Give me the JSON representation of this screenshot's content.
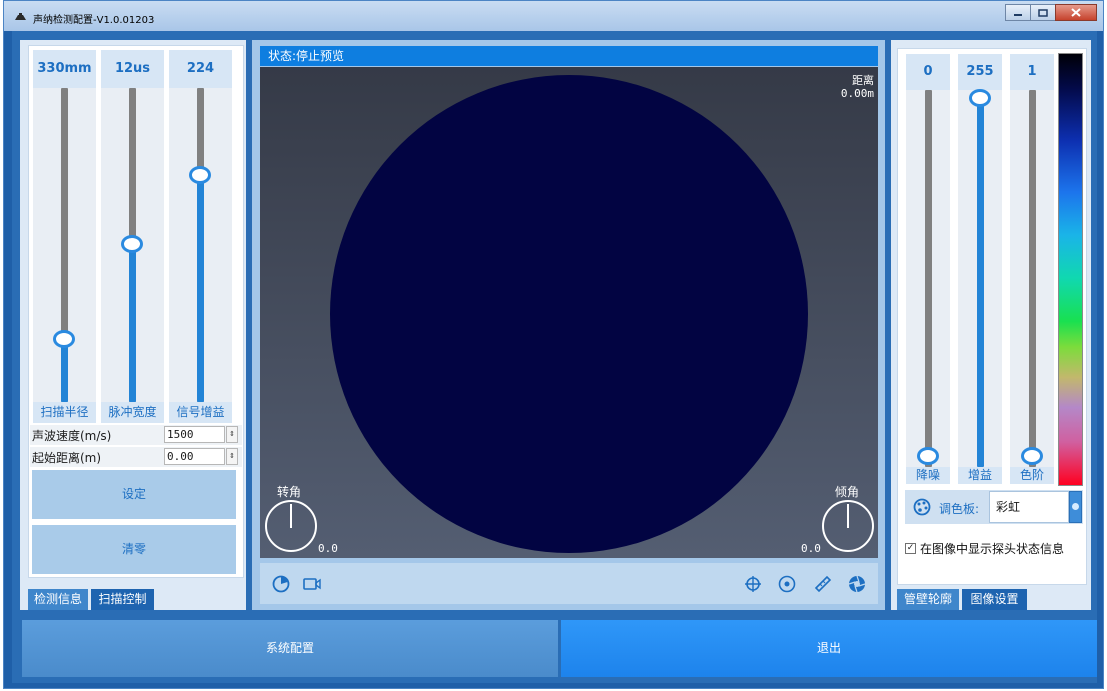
{
  "window": {
    "title": "声纳检测配置-V1.0.01203"
  },
  "left_panel": {
    "sliders": [
      {
        "value_text": "330mm",
        "label": "扫描半径",
        "level": 0.19
      },
      {
        "value_text": "12us",
        "label": "脉冲宽度",
        "level": 0.45
      },
      {
        "value_text": "224",
        "label": "信号增益",
        "level": 0.72
      }
    ],
    "params": [
      {
        "label": "声波速度(m/s)",
        "value": "1500"
      },
      {
        "label": "起始距离(m)",
        "value": "0.00"
      }
    ],
    "set_button": "设定",
    "clear_button": "清零",
    "tabs": [
      {
        "label": "检测信息",
        "active": false
      },
      {
        "label": "扫描控制",
        "active": true
      }
    ]
  },
  "center_panel": {
    "status": "状态:停止预览",
    "distance_label": "距离",
    "distance_value": "0.00m",
    "rotation_label": "转角",
    "rotation_value": "0.0",
    "tilt_label": "倾角",
    "tilt_value": "0.0",
    "toolbar_icons": [
      "sonar-icon",
      "video-icon",
      "crosshair-icon",
      "target-icon",
      "ruler-icon",
      "aperture-icon"
    ]
  },
  "right_panel": {
    "sliders": [
      {
        "value_text": "0",
        "label": "降噪",
        "level": 0.0
      },
      {
        "value_text": "255",
        "label": "增益",
        "level": 1.0
      },
      {
        "value_text": "1",
        "label": "色阶",
        "level": 0.0
      }
    ],
    "palette_label": "调色板:",
    "palette_value": "彩虹",
    "show_status_checked": true,
    "show_status_label": "在图像中显示探头状态信息",
    "tabs": [
      {
        "label": "管壁轮廓",
        "active": false
      },
      {
        "label": "图像设置",
        "active": true
      }
    ]
  },
  "bottom": {
    "config_button": "系统配置",
    "exit_button": "退出"
  },
  "colors": {
    "accent": "#1d6fc2",
    "status_bar": "#0e7ee0",
    "sonar_disc": "#020442",
    "client_bg": "#2a6db5"
  }
}
